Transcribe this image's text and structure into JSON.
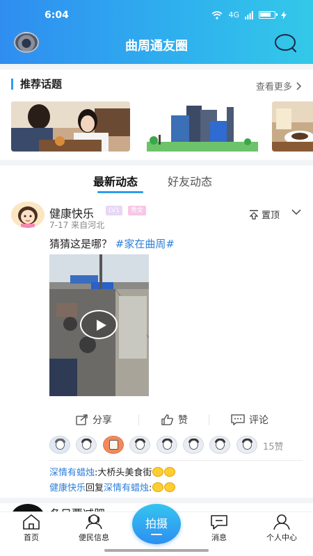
{
  "status_bar": {
    "time": "6:04",
    "network": "4G"
  },
  "header": {
    "title": "曲周通友圈"
  },
  "topics": {
    "title": "推荐话题",
    "more": "查看更多"
  },
  "tabs": [
    {
      "label": "最新动态",
      "active": true
    },
    {
      "label": "好友动态",
      "active": false
    }
  ],
  "post": {
    "author": "健康快乐",
    "level_badge": "LV1",
    "gender_badge": "秀女",
    "date": "7-17",
    "location": "来自河北",
    "pin_label": "置顶",
    "text": "猜猜这是哪？",
    "hashtag": "#家在曲周#",
    "actions": {
      "share": "分享",
      "like": "赞",
      "comment": "评论"
    },
    "like_count": "15赞",
    "comments": [
      {
        "author": "深情有蜡烛",
        "text": "大桥头美食街"
      },
      {
        "author": "健康快乐",
        "reply_word": "回复",
        "target": "深情有蜡烛",
        "text": ""
      }
    ]
  },
  "next_post": {
    "author": "冬日要减肥"
  },
  "bottom_nav": {
    "home": "首页",
    "info": "便民信息",
    "shoot": "拍摄",
    "messages": "消息",
    "profile": "个人中心"
  },
  "colors": {
    "accent": "#2f9bef",
    "link": "#2f7fd8",
    "badge_lv": "#e8d7f5",
    "badge_gender": "#f7c6e6"
  }
}
